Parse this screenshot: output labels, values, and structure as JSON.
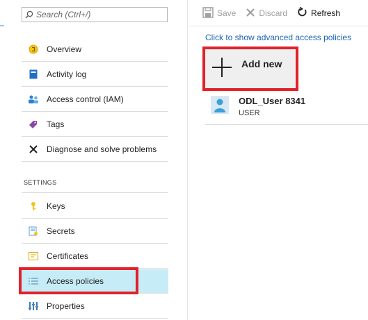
{
  "search": {
    "placeholder": "Search (Ctrl+/)"
  },
  "nav": {
    "items": [
      {
        "label": "Overview"
      },
      {
        "label": "Activity log"
      },
      {
        "label": "Access control (IAM)"
      },
      {
        "label": "Tags"
      },
      {
        "label": "Diagnose and solve problems"
      }
    ],
    "settings_heading": "SETTINGS",
    "settings_items": [
      {
        "label": "Keys"
      },
      {
        "label": "Secrets"
      },
      {
        "label": "Certificates"
      },
      {
        "label": "Access policies",
        "selected": true
      },
      {
        "label": "Properties"
      }
    ]
  },
  "toolbar": {
    "save_label": "Save",
    "discard_label": "Discard",
    "refresh_label": "Refresh"
  },
  "main": {
    "advanced_link": "Click to show advanced access policies",
    "add_new_label": "Add new",
    "users": [
      {
        "name": "ODL_User 8341",
        "type": "USER"
      }
    ]
  },
  "colors": {
    "highlight_red": "#e0222b",
    "selected_bg": "#c6ecf8",
    "link_blue": "#1a63b8"
  }
}
